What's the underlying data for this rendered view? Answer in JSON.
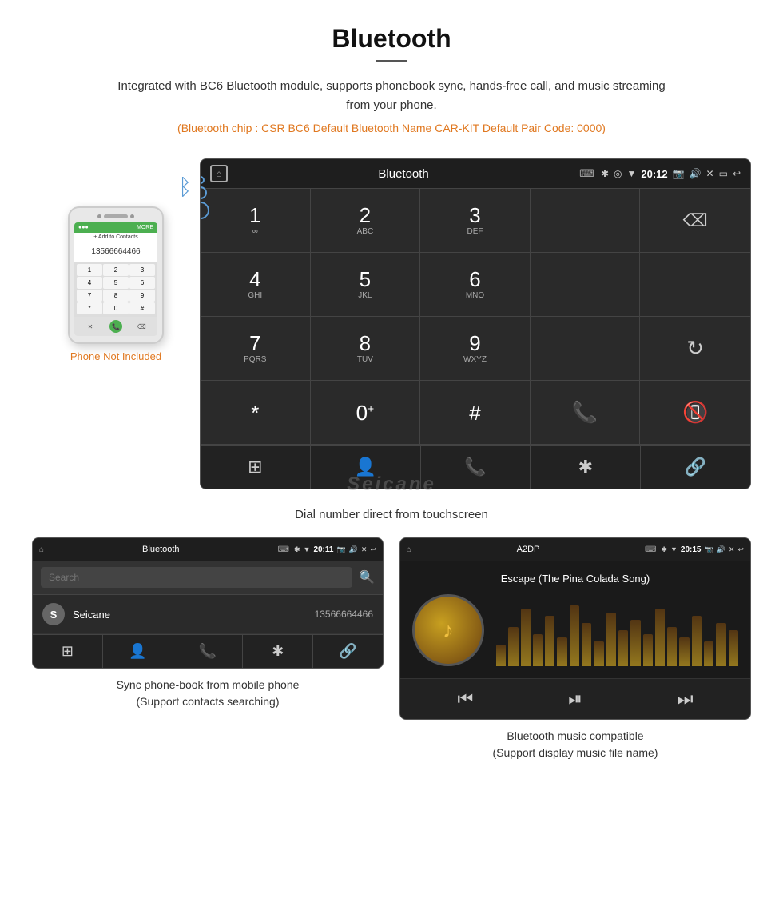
{
  "header": {
    "title": "Bluetooth",
    "description": "Integrated with BC6 Bluetooth module, supports phonebook sync, hands-free call, and music streaming from your phone.",
    "specs": "(Bluetooth chip : CSR BC6    Default Bluetooth Name CAR-KIT    Default Pair Code: 0000)"
  },
  "dial_screen": {
    "status_bar": {
      "title": "Bluetooth",
      "usb_icon": "⌨",
      "time": "20:12"
    },
    "keys": [
      {
        "num": "1",
        "letters": "∞"
      },
      {
        "num": "2",
        "letters": "ABC"
      },
      {
        "num": "3",
        "letters": "DEF"
      },
      {
        "num": "",
        "letters": ""
      },
      {
        "num": "⌫",
        "letters": ""
      },
      {
        "num": "4",
        "letters": "GHI"
      },
      {
        "num": "5",
        "letters": "JKL"
      },
      {
        "num": "6",
        "letters": "MNO"
      },
      {
        "num": "",
        "letters": ""
      },
      {
        "num": "",
        "letters": ""
      },
      {
        "num": "7",
        "letters": "PQRS"
      },
      {
        "num": "8",
        "letters": "TUV"
      },
      {
        "num": "9",
        "letters": "WXYZ"
      },
      {
        "num": "",
        "letters": ""
      },
      {
        "num": "↻",
        "letters": ""
      },
      {
        "num": "*",
        "letters": ""
      },
      {
        "num": "0+",
        "letters": ""
      },
      {
        "num": "#",
        "letters": ""
      },
      {
        "num": "📞",
        "letters": ""
      },
      {
        "num": "📞end",
        "letters": ""
      }
    ],
    "nav_items": [
      "⊞",
      "👤",
      "📞",
      "✱",
      "🔗"
    ]
  },
  "dial_caption": "Dial number direct from touchscreen",
  "phone_not_included": "Phone Not Included",
  "phonebook_screen": {
    "status": {
      "title": "Bluetooth",
      "time": "20:11"
    },
    "search_placeholder": "Search",
    "contacts": [
      {
        "initial": "S",
        "name": "Seicane",
        "number": "13566664466"
      }
    ],
    "nav_icons": [
      "⊞",
      "👤",
      "📞",
      "✱",
      "🔗"
    ]
  },
  "phonebook_caption_line1": "Sync phone-book from mobile phone",
  "phonebook_caption_line2": "(Support contacts searching)",
  "music_screen": {
    "status": {
      "title": "A2DP",
      "time": "20:15"
    },
    "song_title": "Escape (The Pina Colada Song)",
    "controls": [
      "⏮",
      "⏭|",
      "⏭"
    ]
  },
  "music_caption_line1": "Bluetooth music compatible",
  "music_caption_line2": "(Support display music file name)",
  "visualizer_bars": [
    30,
    55,
    80,
    45,
    70,
    40,
    85,
    60,
    35,
    75,
    50,
    65,
    45,
    80,
    55,
    40,
    70,
    35,
    60,
    50
  ],
  "watermark": "Seicane"
}
